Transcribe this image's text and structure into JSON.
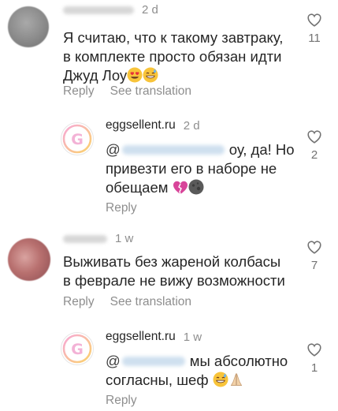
{
  "comments": [
    {
      "type": "comment",
      "author": "",
      "time": "2 d",
      "text": "Я считаю, что к такому завтраку, в комплекте просто обязан идти Джуд Лоу",
      "emojis": [
        "heart-eyes",
        "grin-sweat"
      ],
      "actions": [
        "Reply",
        "See translation"
      ],
      "likes": "11"
    },
    {
      "type": "reply",
      "author": "eggsellent.ru",
      "time": "2 d",
      "mention": "@",
      "text": "оу, да! Но привезти его в наборе не обещаем",
      "emojis": [
        "broken-heart",
        "new-moon-face"
      ],
      "actions": [
        "Reply"
      ],
      "likes": "2"
    },
    {
      "type": "comment",
      "author": "",
      "time": "1 w",
      "text": "Выживать без жареной колбасы в феврале не вижу возможности",
      "emojis": [],
      "actions": [
        "Reply",
        "See translation"
      ],
      "likes": "7"
    },
    {
      "type": "reply",
      "author": "eggsellent.ru",
      "time": "1 w",
      "mention": "@",
      "text": "мы абсолютно согласны, шеф",
      "emojis": [
        "grin-sweat",
        "folded-hands"
      ],
      "actions": [
        "Reply"
      ],
      "likes": "1"
    }
  ],
  "colors": {
    "text": "#262626",
    "muted": "#8e8e8e",
    "brand_gradient_start": "#f7a8d8",
    "brand_gradient_end": "#fbd36b"
  },
  "text_lines": {
    "c1_l1": "Я считаю, что к такому завтраку,",
    "c1_l2": "в комплекте просто обязан идти",
    "c1_l3": "Джуд Лоу",
    "c2_l1_mention": "@",
    "c2_l1_after": "оу, да! Но",
    "c2_l2": "привезти его в наборе не",
    "c2_l3": "обещаем",
    "c3_l1": "Выживать без жареной колбасы",
    "c3_l2": "в феврале не вижу возможности",
    "c4_l1_mention": "@",
    "c4_l1_after": "мы абсолютно",
    "c4_l2": "согласны, шеф"
  },
  "brand_letter": "G"
}
